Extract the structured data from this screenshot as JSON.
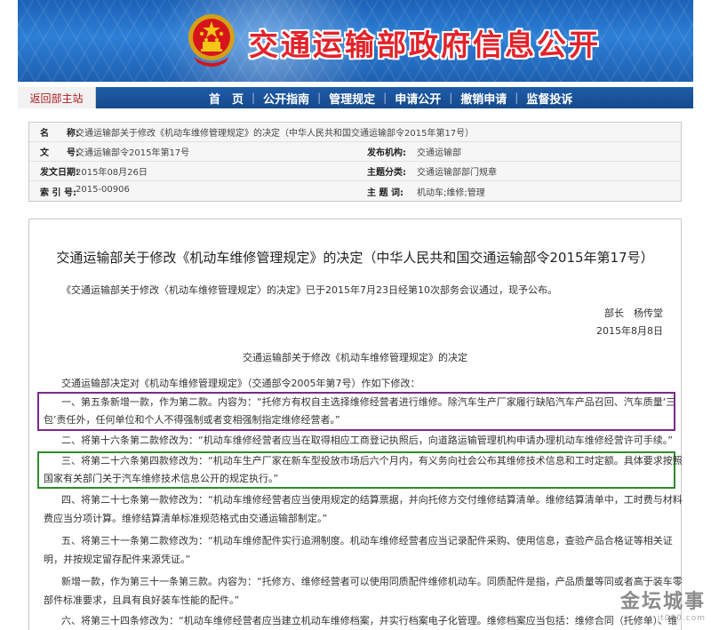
{
  "header": {
    "site_title": "交通运输部政府信息公开",
    "emblem": "national-emblem-icon"
  },
  "nav": {
    "back_home": "返回部主站",
    "items": [
      "首　页",
      "公开指南",
      "管理规定",
      "申请公开",
      "撤销申请",
      "监督投诉"
    ],
    "separator": "|"
  },
  "meta": {
    "name_label": "名　　称:",
    "name_value": "交通运输部关于修改《机动车维修管理规定》的决定（中华人民共和国交通运输部令2015年第17号）",
    "doc_no_label": "文　　号:",
    "doc_no_value": "交通运输部令2015年第17号",
    "issuer_label": "发布机构:",
    "issuer_value": "交通运输部",
    "date_label": "发文日期:",
    "date_value": "2015年08月26日",
    "category_label": "主题分类:",
    "category_value": "交通运输部部门规章",
    "index_label": "索 引 号:",
    "index_value": "2015-00906",
    "keywords_label": "主 题 词:",
    "keywords_value": "机动车;维修;管理"
  },
  "doc": {
    "title": "交通运输部关于修改《机动车维修管理规定》的决定（中华人民共和国交通运输部令2015年第17号）",
    "intro": "《交通运输部关于修改〈机动车维修管理规定〉的决定》已于2015年7月23日经第10次部务会议通过，现予公布。",
    "signer": "部长　杨传堂",
    "sign_date": "2015年8月8日",
    "subtitle": "交通运输部关于修改《机动车维修管理规定》的决定",
    "lead": "交通运输部决定对《机动车维修管理规定》（交通部令2005年第7号）作如下修改：",
    "item1_line1": "一、第五条新增一款，作为第二款。内容为：“托修方有权自主选择维修经营者进行维修。除汽车生产厂家履行缺陷汽车产品召回、汽车质量‘三",
    "item1_line2": "包’责任外，任何单位和个人不得强制或者变相强制指定维修经营者。”",
    "item2": "二、将第十六条第二款修改为：“机动车维修经营者应当在取得相应工商登记执照后，向道路运输管理机构申请办理机动车维修经营许可手续。”",
    "item3_line1": "三、将第二十六条第四款修改为：“机动车生产厂家在新车型投放市场后六个月内，有义务向社会公布其维修技术信息和工时定额。具体要求按照",
    "item3_line2": "国家有关部门关于汽车维修技术信息公开的规定执行。”",
    "item4_line1": "四、将第二十七条第一款修改为：“机动车维修经营者应当使用规定的结算票据，并向托修方交付维修结算清单。维修结算清单中，工时费与材料",
    "item4_line2": "费应当分项计算。维修结算清单标准规范格式由交通运输部制定。”",
    "item5_line1": "五、将第三十一条第二款修改为：“机动车维修配件实行追溯制度。机动车维修经营者应当记录配件采购、使用信息，查验产品合格证等相关证",
    "item5_line2": "明，并按规定留存配件来源凭证。”",
    "item6_line1": "新增一款，作为第三十一条第三款。内容为：“托修方、维修经营者可以使用同质配件维修机动车。同质配件是指，产品质量等同或者高于装车零",
    "item6_line2": "部件标准要求，且具有良好装车性能的配件。”",
    "item7": "六、将第三十四条修改为：“机动车维修经营者应当建立机动车维修档案，并实行档案电子化管理。维修档案应当包括：维修合同（托修单）、维"
  },
  "watermark": {
    "main": "金坛城事",
    "sub": "jt000.com"
  },
  "colors": {
    "banner_blue": "#1b61b6",
    "nav_blue": "#164a8c",
    "title_red": "#e3222a",
    "highlight_purple": "#7a2a8c",
    "highlight_green": "#2e8b2e"
  }
}
